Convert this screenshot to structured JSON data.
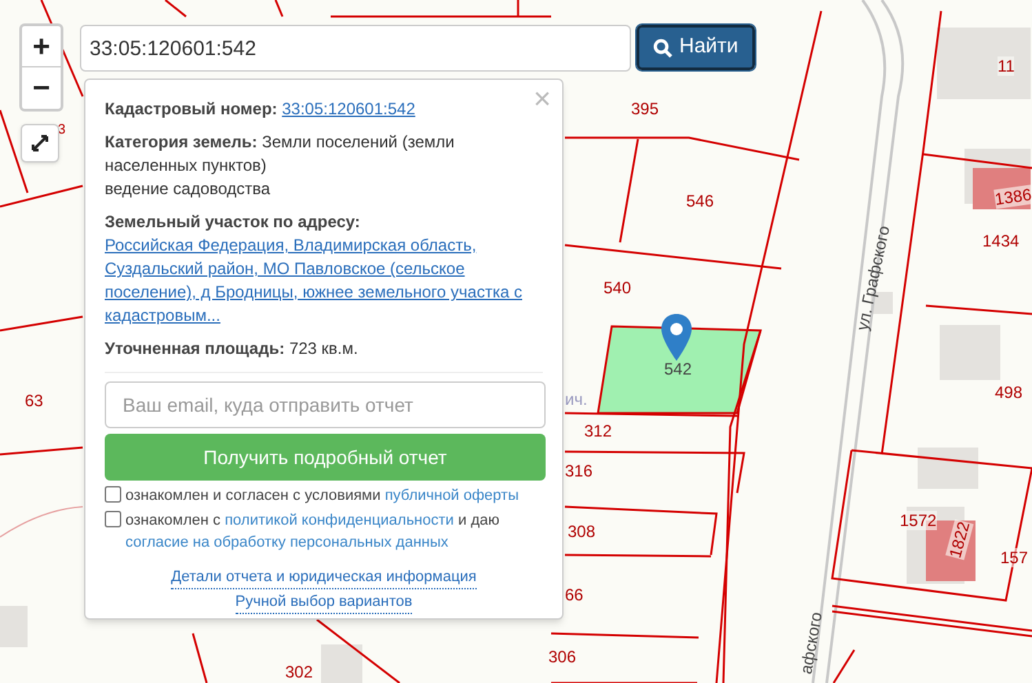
{
  "search": {
    "value": "33:05:120601:542",
    "button": "Найти"
  },
  "zoom_controls": [
    "+",
    "−"
  ],
  "popup": {
    "close": "×",
    "cadastral": {
      "label": "Кадастровый номер:",
      "link": "33:05:120601:542"
    },
    "category": {
      "label": "Категория земель:",
      "text": "Земли поселений (земли населенных пунктов)",
      "usage": "ведение садоводства"
    },
    "address": {
      "label": "Земельный участок по адресу:",
      "link": "Российская Федерация, Владимирская область, Суздальский район, МО Павловское (сельское поселение), д Бродницы, южнее земельного участка с кадастровым..."
    },
    "area": {
      "label": "Уточненная площадь:",
      "text": "723 кв.м."
    },
    "email": {
      "placeholder": "Ваш email, куда отправить отчет"
    },
    "submit": "Получить подробный отчет",
    "agreements": [
      {
        "checked": false,
        "parts": [
          {
            "text": "ознакомлен и согласен с условиями "
          },
          {
            "link": "публичной оферты"
          }
        ]
      },
      {
        "checked": false,
        "parts": [
          {
            "text": "ознакомлен с "
          },
          {
            "link": "политикой конфиденциальности"
          },
          {
            "text": " и даю "
          },
          {
            "link": "согласие на обработку персональных данных"
          }
        ]
      }
    ],
    "footer_links": [
      "Детали отчета и юридическая информация",
      "Ручной выбор вариантов"
    ]
  },
  "map_labels": [
    {
      "text": "395"
    },
    {
      "text": "546"
    },
    {
      "text": "540"
    },
    {
      "text": "542"
    },
    {
      "text": "ич."
    },
    {
      "text": "312"
    },
    {
      "text": "316"
    },
    {
      "text": "308"
    },
    {
      "text": "66"
    },
    {
      "text": "306"
    },
    {
      "text": "302"
    },
    {
      "text": "63"
    },
    {
      "text": "3"
    },
    {
      "text": "11"
    },
    {
      "text": "1386"
    },
    {
      "text": "1434"
    },
    {
      "text": "498"
    },
    {
      "text": "1572"
    },
    {
      "text": "1822"
    },
    {
      "text": "157"
    },
    {
      "text": "ул. Графского"
    },
    {
      "text": "афского"
    }
  ]
}
